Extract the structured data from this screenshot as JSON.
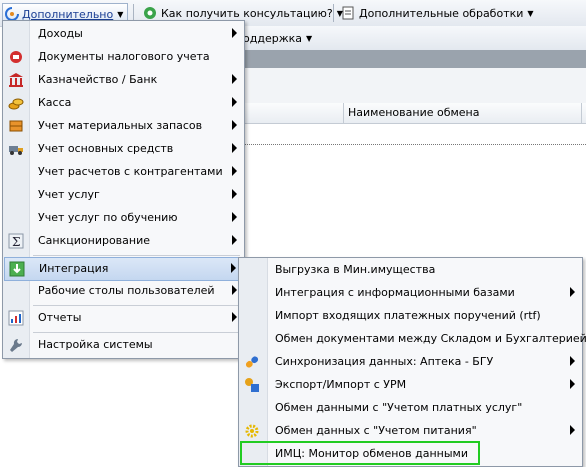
{
  "toolbar": {
    "additional": "Дополнительно",
    "consult": "Как получить консультацию?",
    "extra_processing": "Дополнительные обработки"
  },
  "toolbar2": {
    "support": "оддержка"
  },
  "grid": {
    "column_exchange_name": "Наименование обмена"
  },
  "menu": {
    "items": [
      {
        "label": "Доходы"
      },
      {
        "label": "Документы налогового учета"
      },
      {
        "label": "Казначейство / Банк"
      },
      {
        "label": "Касса"
      },
      {
        "label": "Учет материальных запасов"
      },
      {
        "label": "Учет основных средств"
      },
      {
        "label": "Учет расчетов с контрагентами"
      },
      {
        "label": "Учет услуг"
      },
      {
        "label": "Учет услуг по обучению"
      },
      {
        "label": "Санкционирование"
      },
      {
        "label": "Интеграция"
      },
      {
        "label": "Рабочие столы пользователей"
      },
      {
        "label": "Отчеты"
      },
      {
        "label": "Настройка системы"
      }
    ]
  },
  "submenu": {
    "items": [
      {
        "label": "Выгрузка в Мин.имущества"
      },
      {
        "label": "Интеграция с информационными базами"
      },
      {
        "label": "Импорт входящих платежных поручений (rtf)"
      },
      {
        "label": "Обмен документами между Складом и Бухгалтерией"
      },
      {
        "label": "Синхронизация данных: Аптека - БГУ"
      },
      {
        "label": "Экспорт/Импорт с УРМ"
      },
      {
        "label": "Обмен данными с \"Учетом платных услуг\""
      },
      {
        "label": "Обмен данных с \"Учетом питания\""
      },
      {
        "label": "ИМЦ: Монитор обменов данными"
      }
    ]
  },
  "colors": {
    "highlight": "#c4d7f0",
    "selection_outline": "#22cc22"
  }
}
